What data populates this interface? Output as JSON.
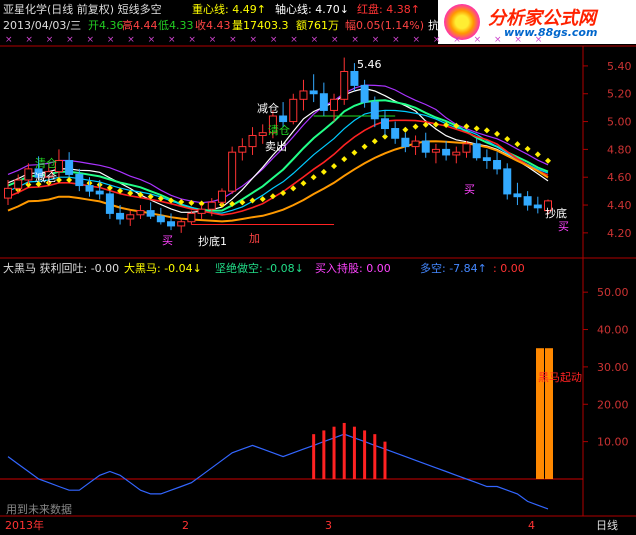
{
  "header": {
    "title": "亚星化学(日线 前复权) 短线多空",
    "zhongxin": "重心线: 4.49↑",
    "zhouxin": "轴心线: 4.70↓",
    "hongpan": "红盘: 4.38↑",
    "date": "2013/04/03/三",
    "open": "开4.36",
    "high": "高4.44",
    "low": "低4.33",
    "close": "收4.43",
    "volume": "量17403.3",
    "amount": "额761万",
    "change": "幅0.05(1.14%)",
    "tail": "抗"
  },
  "logo": {
    "main": "分析家公式网",
    "sub": "www.88gs.com"
  },
  "lower_header": {
    "dhm_profit": "大黑马  获利回吐: -0.00",
    "dhm": "大黑马: -0.04↓",
    "jjzk": "坚绝做空: -0.08↓",
    "mrcg": "买入持股: 0.00",
    "dk": "多空: -7.84↑",
    "dk2": ": 0.00"
  },
  "footer": {
    "year": "2013年",
    "m2": "2",
    "m3": "3",
    "m4": "4",
    "period": "日线",
    "note": "用到未来数据"
  },
  "annotations": [
    {
      "text": "清仓",
      "color": "#22dd22"
    },
    {
      "text": "减仓",
      "color": "#ffffff"
    },
    {
      "text": "减仓",
      "color": "#ffffff"
    },
    {
      "text": "清仓",
      "color": "#22dd22"
    },
    {
      "text": "卖出",
      "color": "#ffffff"
    },
    {
      "text": "抄底1",
      "color": "#ffffff"
    },
    {
      "text": "加",
      "color": "#ff4444"
    },
    {
      "text": "买",
      "color": "#ff44ff"
    },
    {
      "text": "买",
      "color": "#ff44ff"
    },
    {
      "text": "抄底",
      "color": "#ffffff"
    },
    {
      "text": "买",
      "color": "#ff44ff"
    },
    {
      "text": "5.46",
      "color": "#ffffff"
    },
    {
      "text": "黑马起动",
      "color": "#ff2222"
    }
  ],
  "chart_data": [
    {
      "type": "candlestick",
      "ylim": [
        4.12,
        5.5
      ],
      "yticks": [
        "5.40",
        "5.20",
        "5.00",
        "4.80",
        "4.60",
        "4.40",
        "4.20"
      ],
      "candles": [
        [
          4.45,
          4.58,
          4.4,
          4.52
        ],
        [
          4.52,
          4.62,
          4.48,
          4.58
        ],
        [
          4.58,
          4.7,
          4.55,
          4.66
        ],
        [
          4.66,
          4.75,
          4.58,
          4.6
        ],
        [
          4.6,
          4.7,
          4.55,
          4.64
        ],
        [
          4.64,
          4.8,
          4.6,
          4.72
        ],
        [
          4.72,
          4.78,
          4.6,
          4.62
        ],
        [
          4.62,
          4.66,
          4.5,
          4.54
        ],
        [
          4.54,
          4.6,
          4.46,
          4.5
        ],
        [
          4.5,
          4.58,
          4.44,
          4.48
        ],
        [
          4.48,
          4.5,
          4.3,
          4.34
        ],
        [
          4.34,
          4.4,
          4.26,
          4.3
        ],
        [
          4.3,
          4.36,
          4.25,
          4.33
        ],
        [
          4.33,
          4.4,
          4.3,
          4.36
        ],
        [
          4.36,
          4.42,
          4.3,
          4.32
        ],
        [
          4.32,
          4.38,
          4.26,
          4.28
        ],
        [
          4.28,
          4.34,
          4.22,
          4.25
        ],
        [
          4.25,
          4.3,
          4.2,
          4.28
        ],
        [
          4.28,
          4.36,
          4.26,
          4.34
        ],
        [
          4.34,
          4.4,
          4.3,
          4.37
        ],
        [
          4.37,
          4.45,
          4.32,
          4.42
        ],
        [
          4.42,
          4.52,
          4.4,
          4.5
        ],
        [
          4.5,
          4.82,
          4.48,
          4.78
        ],
        [
          4.78,
          4.88,
          4.72,
          4.82
        ],
        [
          4.82,
          4.96,
          4.76,
          4.9
        ],
        [
          4.9,
          4.98,
          4.84,
          4.92
        ],
        [
          4.92,
          5.08,
          4.88,
          5.04
        ],
        [
          5.04,
          5.14,
          4.96,
          5.0
        ],
        [
          5.0,
          5.2,
          4.98,
          5.16
        ],
        [
          5.16,
          5.3,
          5.08,
          5.22
        ],
        [
          5.22,
          5.34,
          5.14,
          5.2
        ],
        [
          5.2,
          5.28,
          5.04,
          5.08
        ],
        [
          5.08,
          5.2,
          5.0,
          5.16
        ],
        [
          5.16,
          5.46,
          5.12,
          5.36
        ],
        [
          5.36,
          5.42,
          5.22,
          5.26
        ],
        [
          5.26,
          5.3,
          5.1,
          5.14
        ],
        [
          5.14,
          5.18,
          4.96,
          5.02
        ],
        [
          5.02,
          5.08,
          4.9,
          4.95
        ],
        [
          4.95,
          5.0,
          4.84,
          4.88
        ],
        [
          4.88,
          4.92,
          4.78,
          4.82
        ],
        [
          4.82,
          4.9,
          4.76,
          4.86
        ],
        [
          4.86,
          4.92,
          4.74,
          4.78
        ],
        [
          4.78,
          4.84,
          4.7,
          4.8
        ],
        [
          4.8,
          4.86,
          4.72,
          4.76
        ],
        [
          4.76,
          4.82,
          4.7,
          4.78
        ],
        [
          4.78,
          4.86,
          4.74,
          4.84
        ],
        [
          4.84,
          4.88,
          4.72,
          4.74
        ],
        [
          4.74,
          4.8,
          4.66,
          4.72
        ],
        [
          4.72,
          4.78,
          4.62,
          4.66
        ],
        [
          4.66,
          4.7,
          4.44,
          4.48
        ],
        [
          4.48,
          4.56,
          4.4,
          4.46
        ],
        [
          4.46,
          4.5,
          4.36,
          4.4
        ],
        [
          4.4,
          4.46,
          4.34,
          4.38
        ],
        [
          4.36,
          4.44,
          4.33,
          4.43
        ]
      ]
    },
    {
      "type": "line+bar",
      "ylim": [
        -5,
        57
      ],
      "yticks": [
        "50.00",
        "40.00",
        "30.00",
        "20.00",
        "10.00"
      ],
      "line": [
        6,
        4,
        2,
        0,
        -1,
        -2,
        -3,
        -3,
        -1,
        1,
        2,
        1,
        -1,
        -3,
        -4,
        -4,
        -3,
        -2,
        -1,
        1,
        3,
        5,
        7,
        8,
        9,
        8,
        7,
        6,
        7,
        8,
        9,
        10,
        11,
        12,
        11,
        10,
        9,
        8,
        7,
        6,
        5,
        4,
        3,
        2,
        1,
        0,
        -1,
        -2,
        -2,
        -3,
        -4,
        -6,
        -7,
        -8
      ],
      "bars": [
        {
          "index": 30,
          "value": 12
        },
        {
          "index": 31,
          "value": 13
        },
        {
          "index": 32,
          "value": 14
        },
        {
          "index": 33,
          "value": 15
        },
        {
          "index": 34,
          "value": 14
        },
        {
          "index": 35,
          "value": 13
        },
        {
          "index": 36,
          "value": 12
        },
        {
          "index": 37,
          "value": 10
        }
      ],
      "signal_bars": {
        "value": 35
      }
    }
  ]
}
